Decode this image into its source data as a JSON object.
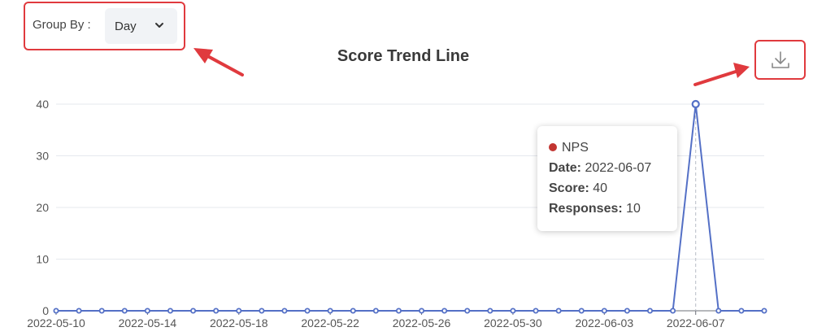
{
  "controls": {
    "group_by_label": "Group By :",
    "group_by_value": "Day"
  },
  "chart_data": {
    "type": "line",
    "title": "Score Trend Line",
    "xlabel": "",
    "ylabel": "",
    "ylim": [
      0,
      40
    ],
    "y_ticks": [
      0,
      10,
      20,
      30,
      40
    ],
    "x_tick_labels": [
      "2022-05-10",
      "2022-05-14",
      "2022-05-18",
      "2022-05-22",
      "2022-05-26",
      "2022-05-30",
      "2022-06-03",
      "2022-06-07"
    ],
    "x": [
      "2022-05-10",
      "2022-05-11",
      "2022-05-12",
      "2022-05-13",
      "2022-05-14",
      "2022-05-15",
      "2022-05-16",
      "2022-05-17",
      "2022-05-18",
      "2022-05-19",
      "2022-05-20",
      "2022-05-21",
      "2022-05-22",
      "2022-05-23",
      "2022-05-24",
      "2022-05-25",
      "2022-05-26",
      "2022-05-27",
      "2022-05-28",
      "2022-05-29",
      "2022-05-30",
      "2022-05-31",
      "2022-06-01",
      "2022-06-02",
      "2022-06-03",
      "2022-06-04",
      "2022-06-05",
      "2022-06-06",
      "2022-06-07",
      "2022-06-08",
      "2022-06-09",
      "2022-06-10"
    ],
    "series": [
      {
        "name": "",
        "color": "#5470c6",
        "values": [
          0,
          0,
          0,
          0,
          0,
          0,
          0,
          0,
          0,
          0,
          0,
          0,
          0,
          0,
          0,
          0,
          0,
          0,
          0,
          0,
          0,
          0,
          0,
          0,
          0,
          0,
          0,
          0,
          40,
          0,
          0,
          0
        ]
      }
    ],
    "grid": true,
    "tooltip": {
      "series_name": "NPS",
      "date_label": "Date:",
      "date_value": "2022-06-07",
      "score_label": "Score:",
      "score_value": "40",
      "responses_label": "Responses:",
      "responses_value": "10"
    }
  },
  "colors": {
    "line": "#5470c6",
    "annotation": "#e03a3e",
    "tooltip_dot": "#c23531"
  }
}
